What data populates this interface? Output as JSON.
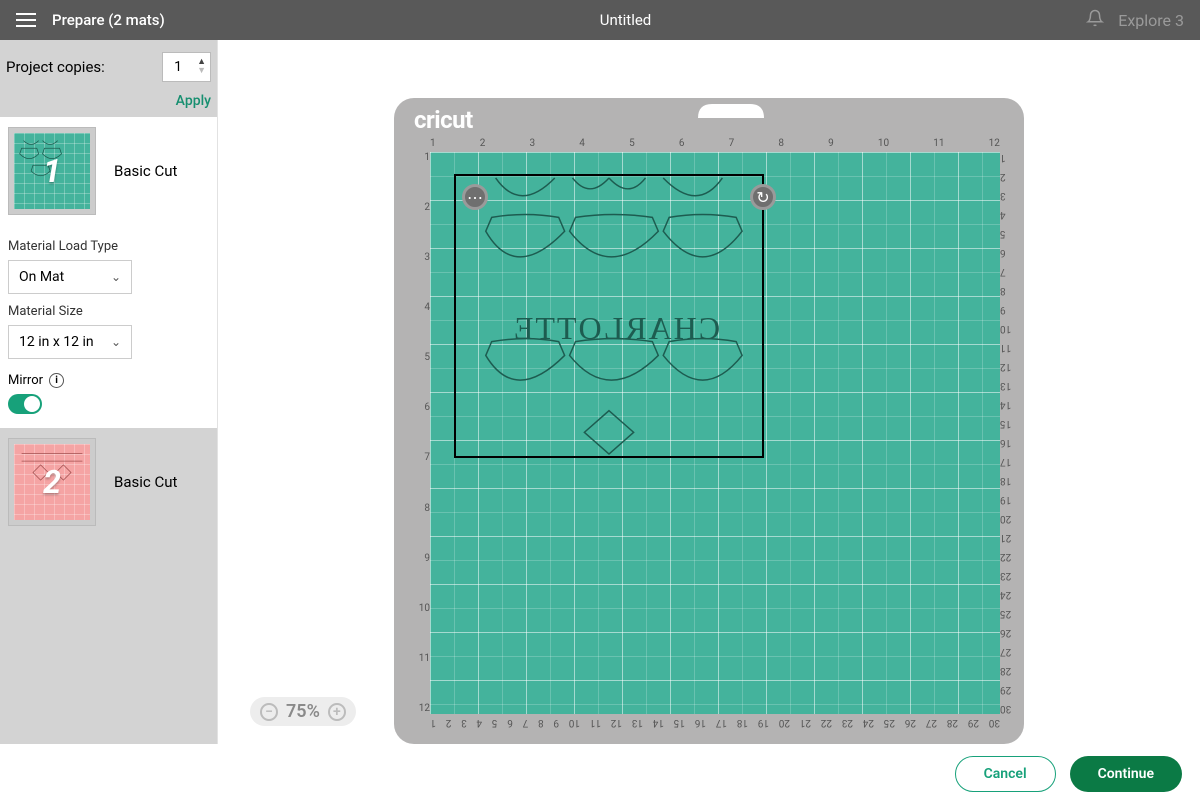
{
  "header": {
    "title": "Prepare (2 mats)",
    "project_name": "Untitled",
    "device": "Explore 3"
  },
  "sidebar": {
    "project_copies_label": "Project copies:",
    "project_copies_value": "1",
    "apply_label": "Apply",
    "mats": [
      {
        "number": "1",
        "operation": "Basic Cut",
        "color": "#44b39c"
      },
      {
        "number": "2",
        "operation": "Basic Cut",
        "color": "#f5a4a4"
      }
    ],
    "material_load_type": {
      "label": "Material Load Type",
      "value": "On Mat"
    },
    "material_size": {
      "label": "Material Size",
      "value": "12 in x 12 in"
    },
    "mirror": {
      "label": "Mirror",
      "on": true
    }
  },
  "mat": {
    "brand": "cricut",
    "ruler_top": [
      "1",
      "2",
      "3",
      "4",
      "5",
      "6",
      "7",
      "8",
      "9",
      "10",
      "11",
      "12"
    ],
    "ruler_left": [
      "1",
      "2",
      "3",
      "4",
      "5",
      "6",
      "7",
      "8",
      "9",
      "10",
      "11",
      "12"
    ],
    "ruler_right": [
      "30",
      "29",
      "28",
      "27",
      "26",
      "25",
      "24",
      "23",
      "22",
      "21",
      "20",
      "19",
      "18",
      "17",
      "16",
      "15",
      "14",
      "13",
      "12",
      "11",
      "10",
      "9",
      "8",
      "7",
      "6",
      "5",
      "4",
      "3",
      "2",
      "1"
    ],
    "ruler_bottom": [
      "30",
      "29",
      "28",
      "27",
      "26",
      "25",
      "24",
      "23",
      "22",
      "21",
      "20",
      "19",
      "18",
      "17",
      "16",
      "15",
      "14",
      "13",
      "12",
      "11",
      "10",
      "9",
      "8",
      "7",
      "6",
      "5",
      "4",
      "3",
      "2",
      "1"
    ],
    "design_text": "CHARLOTTE"
  },
  "zoom": {
    "level": "75%"
  },
  "footer": {
    "cancel": "Cancel",
    "continue": "Continue"
  }
}
